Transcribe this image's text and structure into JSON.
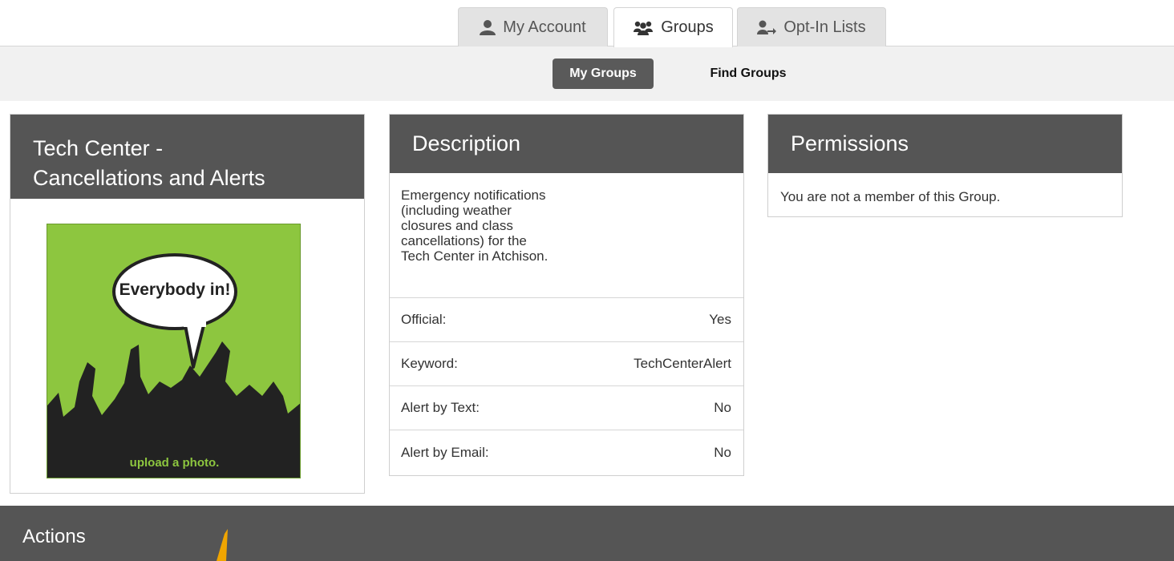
{
  "tabs": [
    {
      "label": "My Account",
      "icon": "user-icon"
    },
    {
      "label": "Groups",
      "icon": "users-icon"
    },
    {
      "label": "Opt-In Lists",
      "icon": "user-signin-icon"
    }
  ],
  "subnav": {
    "my_groups": "My Groups",
    "find_groups": "Find Groups"
  },
  "group": {
    "title_line1": "Tech Center -",
    "title_line2": "Cancellations and Alerts",
    "photo_speech": "Everybody in!",
    "photo_caption": "upload a photo."
  },
  "description": {
    "heading": "Description",
    "lines": [
      "Emergency notifications",
      "(including weather",
      "closures and class",
      "cancellations) for the",
      "Tech Center in Atchison."
    ],
    "rows": [
      {
        "label": "Official:",
        "value": "Yes"
      },
      {
        "label": "Keyword:",
        "value": "TechCenterAlert"
      },
      {
        "label": "Alert by Text:",
        "value": "No"
      },
      {
        "label": "Alert by Email:",
        "value": "No"
      }
    ]
  },
  "permissions": {
    "heading": "Permissions",
    "text": "You are not a member of this Group."
  },
  "actions": {
    "title": "Actions"
  },
  "colors": {
    "header": "#555555",
    "photo_green": "#8dc63f",
    "accent": "#f0a500"
  }
}
